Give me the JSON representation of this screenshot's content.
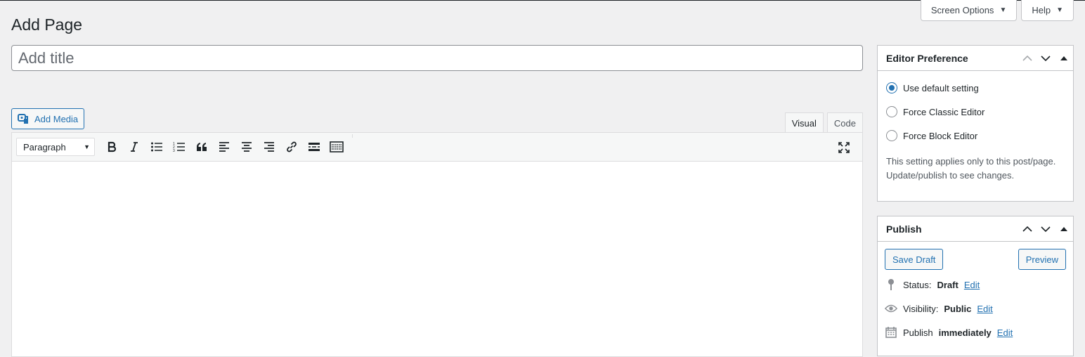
{
  "header": {
    "page_title": "Add Page",
    "screen_options_label": "Screen Options",
    "help_label": "Help"
  },
  "title_field": {
    "placeholder": "Add title",
    "value": ""
  },
  "editor": {
    "add_media_label": "Add Media",
    "tabs": [
      {
        "label": "Visual",
        "active": true
      },
      {
        "label": "Code",
        "active": false
      }
    ],
    "format_select_value": "Paragraph",
    "toolbar_icons": [
      "bold-icon",
      "italic-icon",
      "bulleted-list-icon",
      "numbered-list-icon",
      "blockquote-icon",
      "align-left-icon",
      "align-center-icon",
      "align-right-icon",
      "link-icon",
      "read-more-icon",
      "toolbar-toggle-icon",
      "fullscreen-icon"
    ]
  },
  "editor_preference": {
    "title": "Editor Preference",
    "options": [
      {
        "label": "Use default setting",
        "checked": true
      },
      {
        "label": "Force Classic Editor",
        "checked": false
      },
      {
        "label": "Force Block Editor",
        "checked": false
      }
    ],
    "note": "This setting applies only to this post/page. Update/publish to see changes."
  },
  "publish": {
    "title": "Publish",
    "save_draft_label": "Save Draft",
    "preview_label": "Preview",
    "status_label": "Status:",
    "status_value": "Draft",
    "visibility_label": "Visibility:",
    "visibility_value": "Public",
    "publish_label": "Publish",
    "publish_value": "immediately",
    "edit_label": "Edit"
  },
  "colors": {
    "accent": "#2271b1",
    "background": "#f0f0f1",
    "border": "#c3c4c7"
  }
}
